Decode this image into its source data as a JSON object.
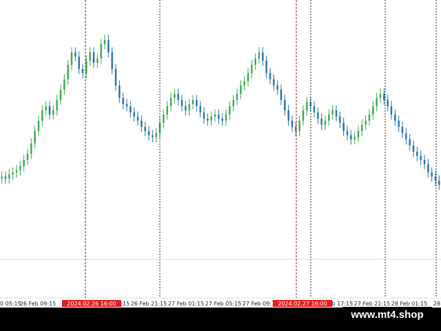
{
  "chart_data": {
    "type": "candlestick",
    "colors": {
      "bull": "#3aa64a",
      "bear": "#1f6fb0",
      "grid_v": "#222222",
      "marker_line": "#8b1a1a",
      "marker_label_bg": "#e02020",
      "axis_line": "#dddddd",
      "bottom_bar": "#000000"
    },
    "y_range": [
      0,
      100
    ],
    "x_tick_labels": [
      "0 05:15",
      "26 Feb 09:15",
      "26 Feb 13:15",
      "26 Feb 17:15",
      "26 Feb 21:15",
      "27 Feb 01:15",
      "27 Feb 05:15",
      "27 Feb 09:15",
      "27 Feb 13:15",
      "27 Feb 17:15",
      "27 Feb 21:15",
      "28 Feb 01:15",
      "28"
    ],
    "markers": [
      {
        "label": "2024.02.26 16:00",
        "index": 124
      },
      {
        "label": "2024.02.27 16:00",
        "index": 430
      }
    ],
    "extra_dotted_lines": [
      232,
      451,
      559,
      633
    ],
    "closes": [
      28,
      27,
      29,
      30,
      31,
      33,
      36,
      39,
      44,
      50,
      55,
      60,
      62,
      58,
      60,
      65,
      70,
      75,
      82,
      88,
      86,
      80,
      78,
      84,
      88,
      83,
      85,
      92,
      94,
      88,
      80,
      72,
      66,
      63,
      62,
      59,
      57,
      55,
      52,
      50,
      48,
      47,
      49,
      54,
      58,
      62,
      66,
      68,
      65,
      62,
      60,
      63,
      65,
      62,
      59,
      56,
      55,
      57,
      58,
      56,
      55,
      58,
      62,
      65,
      68,
      72,
      74,
      78,
      82,
      85,
      88,
      84,
      78,
      75,
      72,
      70,
      65,
      60,
      55,
      52,
      50,
      55,
      60,
      64,
      62,
      59,
      56,
      53,
      55,
      58,
      60,
      57,
      54,
      50,
      48,
      46,
      47,
      50,
      53,
      55,
      58,
      62,
      66,
      68,
      65,
      62,
      58,
      55,
      52,
      49,
      46,
      43,
      40,
      38,
      36,
      34,
      30,
      28,
      26,
      24
    ]
  },
  "watermark": "www.mt4.shop"
}
